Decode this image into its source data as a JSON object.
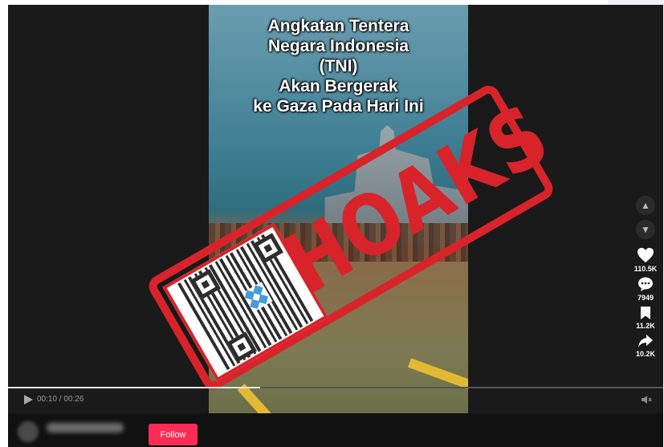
{
  "video": {
    "headline_lines": [
      "Angkatan Tentera",
      "Negara Indonesia",
      "(TNI)",
      "Akan Bergerak",
      "ke Gaza Pada Hari Ini"
    ],
    "stamp_text": "HOAKS"
  },
  "rail": {
    "up_icon": "chevron-up-icon",
    "down_icon": "chevron-down-icon",
    "like_count": "110.5K",
    "comment_count": "7949",
    "save_count": "11.2K",
    "share_count": "10.2K"
  },
  "controls": {
    "time": "00:10 / 00:26",
    "progress_fraction": 0.385
  },
  "bottom": {
    "follow_label": "Follow"
  },
  "colors": {
    "stamp": "#d8232a",
    "follow": "#fe2c55",
    "player_bg": "#1a1a1a"
  }
}
